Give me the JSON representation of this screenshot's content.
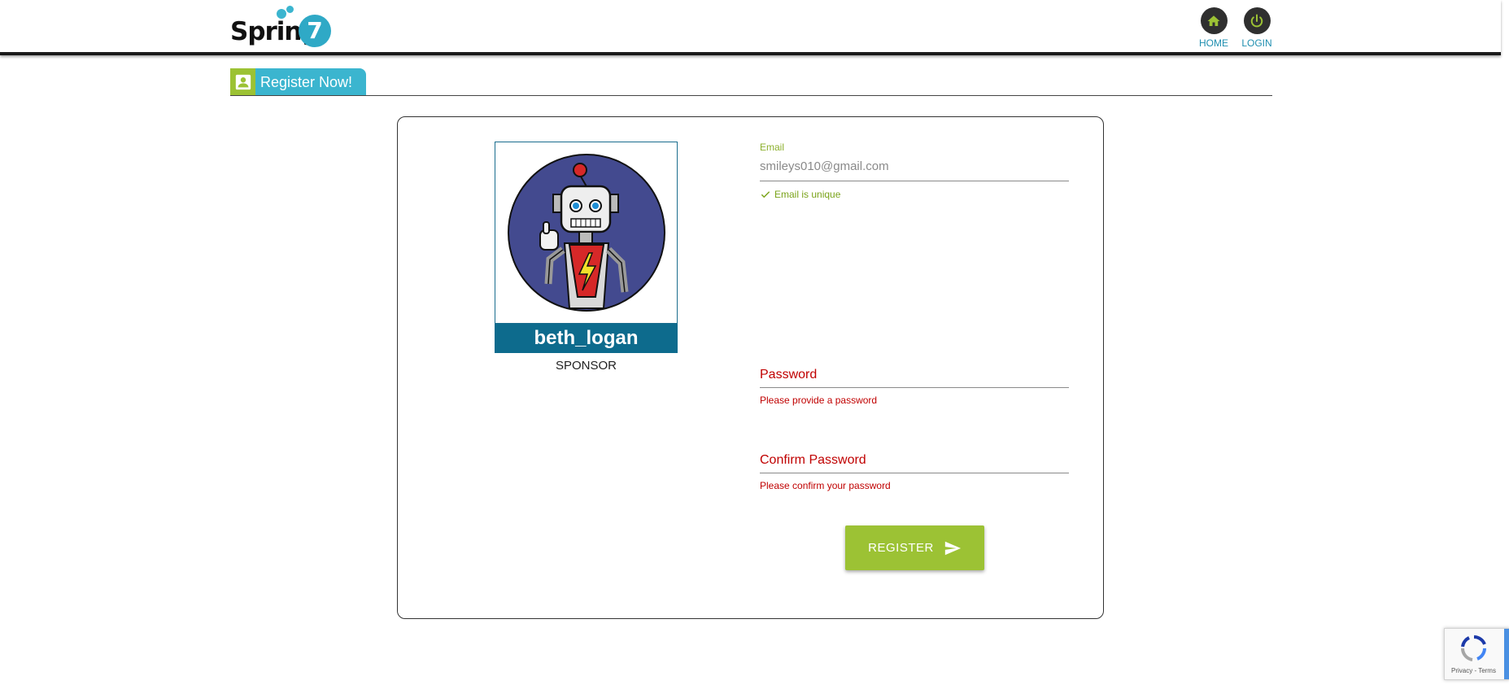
{
  "brand": {
    "logo_text": "Spring",
    "logo_number": "7"
  },
  "nav": {
    "home_label": "HOME",
    "login_label": "LOGIN"
  },
  "tab": {
    "label": "Register Now!"
  },
  "profile": {
    "username": "beth_logan",
    "role": "SPONSOR"
  },
  "form": {
    "email_label": "Email",
    "email_value": "smileys010@gmail.com",
    "email_hint": "Email is unique",
    "password_label": "Password",
    "password_error": "Please provide a password",
    "confirm_label": "Confirm Password",
    "confirm_error": "Please confirm your password",
    "register_label": "REGISTER"
  },
  "recaptcha": {
    "terms": "Privacy - Terms"
  },
  "colors": {
    "accent_green": "#9cc234",
    "accent_blue": "#3bb5cf",
    "name_bar": "#0d6b8d",
    "error_red": "#c00000"
  },
  "icons": {
    "home": "home-icon",
    "login": "power-icon",
    "tab": "contact-card-icon",
    "check": "check-icon",
    "send": "send-icon"
  }
}
